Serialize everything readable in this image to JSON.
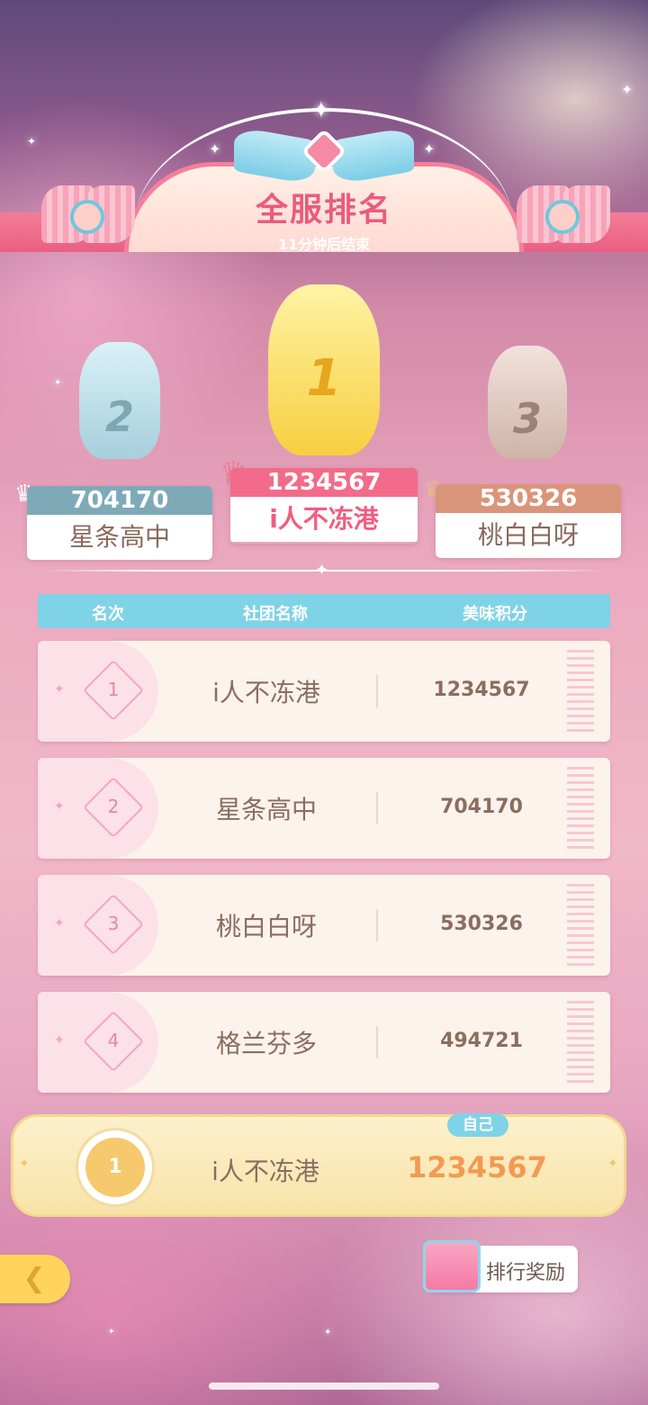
{
  "header": {
    "title": "全服排名",
    "subtitle": "11分钟后结束"
  },
  "podium": [
    {
      "place": "2",
      "score": "704170",
      "name": "星条高中",
      "color": "#7eaab8"
    },
    {
      "place": "1",
      "score": "1234567",
      "name": "i人不冻港",
      "color": "#f26b8a"
    },
    {
      "place": "3",
      "score": "530326",
      "name": "桃白白呀",
      "color": "#d9957a"
    }
  ],
  "table": {
    "headers": {
      "rank": "名次",
      "club": "社团名称",
      "score": "美味积分"
    },
    "rows": [
      {
        "rank": "1",
        "name": "i人不冻港",
        "score": "1234567"
      },
      {
        "rank": "2",
        "name": "星条高中",
        "score": "704170"
      },
      {
        "rank": "3",
        "name": "桃白白呀",
        "score": "530326"
      },
      {
        "rank": "4",
        "name": "格兰芬多",
        "score": "494721"
      }
    ]
  },
  "self": {
    "badge": "自己",
    "rank": "1",
    "name": "i人不冻港",
    "score": "1234567"
  },
  "footer": {
    "reward_label": "排行奖励",
    "back_icon": "back-arrow-icon",
    "gift_icon": "gift-box-icon"
  }
}
